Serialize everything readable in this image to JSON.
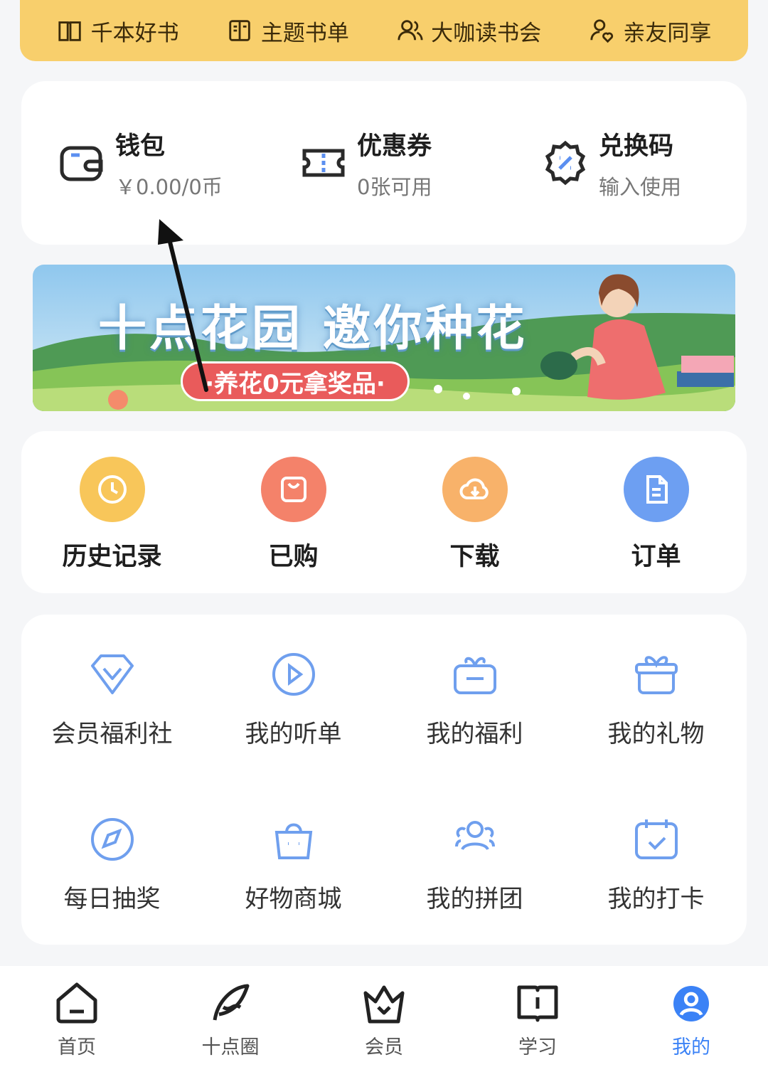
{
  "vip_strip": {
    "items": [
      {
        "label": "千本好书",
        "icon": "book-open-icon"
      },
      {
        "label": "主题书单",
        "icon": "booklist-icon"
      },
      {
        "label": "大咖读书会",
        "icon": "users-icon"
      },
      {
        "label": "亲友同享",
        "icon": "user-heart-icon"
      }
    ]
  },
  "wallet": {
    "items": [
      {
        "title": "钱包",
        "sub": "￥0.00/0币",
        "icon": "wallet-icon"
      },
      {
        "title": "优惠券",
        "sub": "0张可用",
        "icon": "coupon-icon"
      },
      {
        "title": "兑换码",
        "sub": "输入使用",
        "icon": "redeem-code-icon"
      }
    ]
  },
  "banner": {
    "title": "十点花园 邀你种花",
    "pill": "·养花0元拿奖品·"
  },
  "quick": {
    "items": [
      {
        "label": "历史记录",
        "icon": "clock-icon",
        "color": "#f8c65a"
      },
      {
        "label": "已购",
        "icon": "shopping-bag-icon",
        "color": "#f4826a"
      },
      {
        "label": "下载",
        "icon": "cloud-download-icon",
        "color": "#f8b26a"
      },
      {
        "label": "订单",
        "icon": "document-icon",
        "color": "#6d9ff2"
      }
    ]
  },
  "services": {
    "items": [
      {
        "label": "会员福利社",
        "icon": "diamond-icon"
      },
      {
        "label": "我的听单",
        "icon": "play-circle-icon"
      },
      {
        "label": "我的福利",
        "icon": "gift-box-icon"
      },
      {
        "label": "我的礼物",
        "icon": "present-icon"
      },
      {
        "label": "每日抽奖",
        "icon": "compass-icon"
      },
      {
        "label": "好物商城",
        "icon": "shop-bag-icon"
      },
      {
        "label": "我的拼团",
        "icon": "group-icon"
      },
      {
        "label": "我的打卡",
        "icon": "calendar-check-icon"
      }
    ]
  },
  "nav": {
    "items": [
      {
        "label": "首页",
        "icon": "home-icon"
      },
      {
        "label": "十点圈",
        "icon": "feather-icon"
      },
      {
        "label": "会员",
        "icon": "crown-icon"
      },
      {
        "label": "学习",
        "icon": "book-icon"
      },
      {
        "label": "我的",
        "icon": "profile-icon",
        "active": true
      }
    ]
  },
  "colors": {
    "vip_bg": "#f8cf6c",
    "accent_blue": "#3b82f6",
    "icon_blue": "#6f9fee"
  }
}
